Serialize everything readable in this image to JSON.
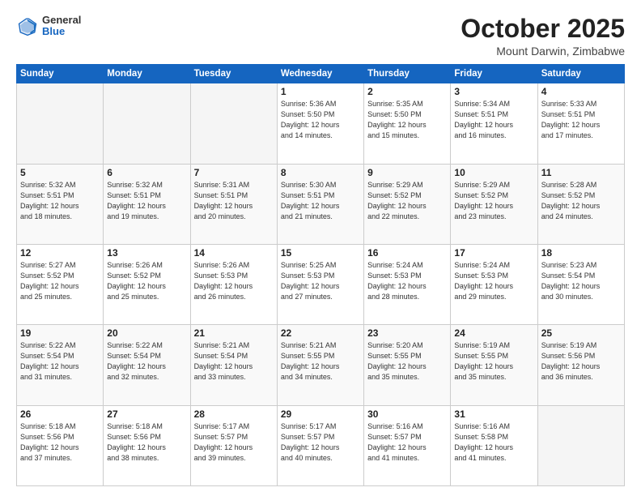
{
  "header": {
    "logo_general": "General",
    "logo_blue": "Blue",
    "month_title": "October 2025",
    "location": "Mount Darwin, Zimbabwe"
  },
  "weekdays": [
    "Sunday",
    "Monday",
    "Tuesday",
    "Wednesday",
    "Thursday",
    "Friday",
    "Saturday"
  ],
  "weeks": [
    [
      {
        "day": "",
        "info": ""
      },
      {
        "day": "",
        "info": ""
      },
      {
        "day": "",
        "info": ""
      },
      {
        "day": "1",
        "info": "Sunrise: 5:36 AM\nSunset: 5:50 PM\nDaylight: 12 hours\nand 14 minutes."
      },
      {
        "day": "2",
        "info": "Sunrise: 5:35 AM\nSunset: 5:50 PM\nDaylight: 12 hours\nand 15 minutes."
      },
      {
        "day": "3",
        "info": "Sunrise: 5:34 AM\nSunset: 5:51 PM\nDaylight: 12 hours\nand 16 minutes."
      },
      {
        "day": "4",
        "info": "Sunrise: 5:33 AM\nSunset: 5:51 PM\nDaylight: 12 hours\nand 17 minutes."
      }
    ],
    [
      {
        "day": "5",
        "info": "Sunrise: 5:32 AM\nSunset: 5:51 PM\nDaylight: 12 hours\nand 18 minutes."
      },
      {
        "day": "6",
        "info": "Sunrise: 5:32 AM\nSunset: 5:51 PM\nDaylight: 12 hours\nand 19 minutes."
      },
      {
        "day": "7",
        "info": "Sunrise: 5:31 AM\nSunset: 5:51 PM\nDaylight: 12 hours\nand 20 minutes."
      },
      {
        "day": "8",
        "info": "Sunrise: 5:30 AM\nSunset: 5:51 PM\nDaylight: 12 hours\nand 21 minutes."
      },
      {
        "day": "9",
        "info": "Sunrise: 5:29 AM\nSunset: 5:52 PM\nDaylight: 12 hours\nand 22 minutes."
      },
      {
        "day": "10",
        "info": "Sunrise: 5:29 AM\nSunset: 5:52 PM\nDaylight: 12 hours\nand 23 minutes."
      },
      {
        "day": "11",
        "info": "Sunrise: 5:28 AM\nSunset: 5:52 PM\nDaylight: 12 hours\nand 24 minutes."
      }
    ],
    [
      {
        "day": "12",
        "info": "Sunrise: 5:27 AM\nSunset: 5:52 PM\nDaylight: 12 hours\nand 25 minutes."
      },
      {
        "day": "13",
        "info": "Sunrise: 5:26 AM\nSunset: 5:52 PM\nDaylight: 12 hours\nand 25 minutes."
      },
      {
        "day": "14",
        "info": "Sunrise: 5:26 AM\nSunset: 5:53 PM\nDaylight: 12 hours\nand 26 minutes."
      },
      {
        "day": "15",
        "info": "Sunrise: 5:25 AM\nSunset: 5:53 PM\nDaylight: 12 hours\nand 27 minutes."
      },
      {
        "day": "16",
        "info": "Sunrise: 5:24 AM\nSunset: 5:53 PM\nDaylight: 12 hours\nand 28 minutes."
      },
      {
        "day": "17",
        "info": "Sunrise: 5:24 AM\nSunset: 5:53 PM\nDaylight: 12 hours\nand 29 minutes."
      },
      {
        "day": "18",
        "info": "Sunrise: 5:23 AM\nSunset: 5:54 PM\nDaylight: 12 hours\nand 30 minutes."
      }
    ],
    [
      {
        "day": "19",
        "info": "Sunrise: 5:22 AM\nSunset: 5:54 PM\nDaylight: 12 hours\nand 31 minutes."
      },
      {
        "day": "20",
        "info": "Sunrise: 5:22 AM\nSunset: 5:54 PM\nDaylight: 12 hours\nand 32 minutes."
      },
      {
        "day": "21",
        "info": "Sunrise: 5:21 AM\nSunset: 5:54 PM\nDaylight: 12 hours\nand 33 minutes."
      },
      {
        "day": "22",
        "info": "Sunrise: 5:21 AM\nSunset: 5:55 PM\nDaylight: 12 hours\nand 34 minutes."
      },
      {
        "day": "23",
        "info": "Sunrise: 5:20 AM\nSunset: 5:55 PM\nDaylight: 12 hours\nand 35 minutes."
      },
      {
        "day": "24",
        "info": "Sunrise: 5:19 AM\nSunset: 5:55 PM\nDaylight: 12 hours\nand 35 minutes."
      },
      {
        "day": "25",
        "info": "Sunrise: 5:19 AM\nSunset: 5:56 PM\nDaylight: 12 hours\nand 36 minutes."
      }
    ],
    [
      {
        "day": "26",
        "info": "Sunrise: 5:18 AM\nSunset: 5:56 PM\nDaylight: 12 hours\nand 37 minutes."
      },
      {
        "day": "27",
        "info": "Sunrise: 5:18 AM\nSunset: 5:56 PM\nDaylight: 12 hours\nand 38 minutes."
      },
      {
        "day": "28",
        "info": "Sunrise: 5:17 AM\nSunset: 5:57 PM\nDaylight: 12 hours\nand 39 minutes."
      },
      {
        "day": "29",
        "info": "Sunrise: 5:17 AM\nSunset: 5:57 PM\nDaylight: 12 hours\nand 40 minutes."
      },
      {
        "day": "30",
        "info": "Sunrise: 5:16 AM\nSunset: 5:57 PM\nDaylight: 12 hours\nand 41 minutes."
      },
      {
        "day": "31",
        "info": "Sunrise: 5:16 AM\nSunset: 5:58 PM\nDaylight: 12 hours\nand 41 minutes."
      },
      {
        "day": "",
        "info": ""
      }
    ]
  ]
}
